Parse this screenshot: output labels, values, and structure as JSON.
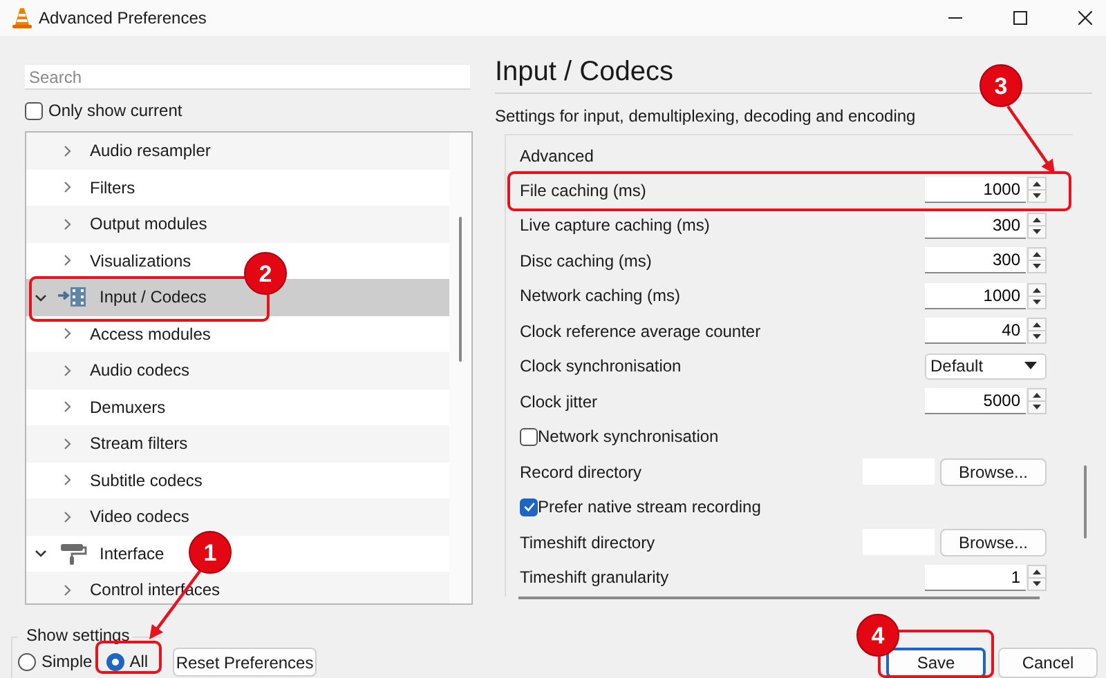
{
  "window": {
    "title": "Advanced Preferences"
  },
  "search": {
    "placeholder": "Search"
  },
  "only_show_current": {
    "label": "Only show current",
    "checked": false
  },
  "tree": {
    "items": [
      {
        "label": "Audio resampler",
        "expanded": false,
        "selected": false
      },
      {
        "label": "Filters",
        "expanded": false,
        "selected": false
      },
      {
        "label": "Output modules",
        "expanded": false,
        "selected": false
      },
      {
        "label": "Visualizations",
        "expanded": false,
        "selected": false
      }
    ],
    "categories": [
      {
        "label": "Input / Codecs",
        "expanded": true,
        "selected": true,
        "children": [
          {
            "label": "Access modules",
            "expanded": false,
            "selected": false
          },
          {
            "label": "Audio codecs",
            "expanded": false,
            "selected": false
          },
          {
            "label": "Demuxers",
            "expanded": false,
            "selected": false
          },
          {
            "label": "Stream filters",
            "expanded": false,
            "selected": false
          },
          {
            "label": "Subtitle codecs",
            "expanded": false,
            "selected": false
          },
          {
            "label": "Video codecs",
            "expanded": false,
            "selected": false
          }
        ]
      },
      {
        "label": "Interface",
        "expanded": true,
        "selected": false,
        "children": [
          {
            "label": "Control interfaces",
            "expanded": false,
            "selected": false
          }
        ]
      }
    ]
  },
  "panel": {
    "title": "Input / Codecs",
    "description": "Settings for input, demultiplexing, decoding and encoding",
    "group": "Advanced",
    "settings": [
      {
        "kind": "number",
        "label": "File caching (ms)",
        "value": "1000"
      },
      {
        "kind": "number",
        "label": "Live capture caching (ms)",
        "value": "300"
      },
      {
        "kind": "number",
        "label": "Disc caching (ms)",
        "value": "300"
      },
      {
        "kind": "number",
        "label": "Network caching (ms)",
        "value": "1000"
      },
      {
        "kind": "number",
        "label": "Clock reference average counter",
        "value": "40"
      },
      {
        "kind": "select",
        "label": "Clock synchronisation",
        "value": "Default"
      },
      {
        "kind": "number",
        "label": "Clock jitter",
        "value": "5000"
      },
      {
        "kind": "checkbox",
        "label": "Network synchronisation",
        "checked": false
      },
      {
        "kind": "directory",
        "label": "Record directory",
        "button": "Browse..."
      },
      {
        "kind": "checkbox",
        "label": "Prefer native stream recording",
        "checked": true
      },
      {
        "kind": "directory",
        "label": "Timeshift directory",
        "button": "Browse..."
      },
      {
        "kind": "number",
        "label": "Timeshift granularity",
        "value": "1"
      }
    ]
  },
  "show_settings": {
    "legend": "Show settings",
    "options": [
      {
        "label": "Simple",
        "selected": false
      },
      {
        "label": "All",
        "selected": true
      }
    ]
  },
  "reset_button": "Reset Preferences",
  "buttons": [
    {
      "label": "Save",
      "default": true
    },
    {
      "label": "Cancel",
      "default": false
    }
  ],
  "annotations": [
    {
      "label": "1"
    },
    {
      "label": "2"
    },
    {
      "label": "3"
    },
    {
      "label": "4"
    }
  ]
}
